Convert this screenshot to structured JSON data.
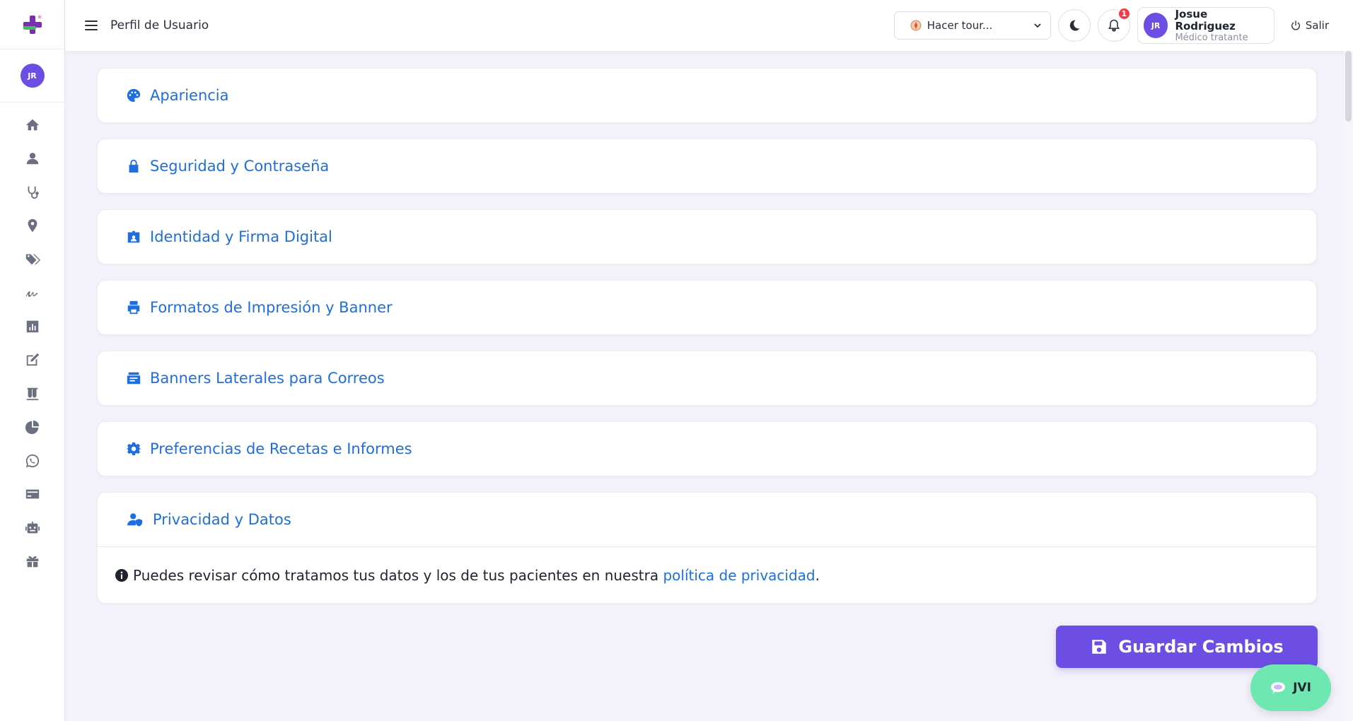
{
  "header": {
    "page_title": "Perfil de Usuario",
    "tour_label": "Hacer tour...",
    "notifications_count": "1",
    "user": {
      "initials": "JR",
      "name": "Josue Rodriguez",
      "role": "Médico tratante"
    },
    "logout_label": "Salir"
  },
  "sidebar": {
    "avatar_initials": "JR",
    "items": [
      {
        "icon": "home-icon"
      },
      {
        "icon": "user-icon"
      },
      {
        "icon": "stethoscope-icon"
      },
      {
        "icon": "location-pin-icon"
      },
      {
        "icon": "tags-icon"
      },
      {
        "icon": "signature-icon"
      },
      {
        "icon": "bar-chart-icon"
      },
      {
        "icon": "edit-icon"
      },
      {
        "icon": "test-tubes-icon"
      },
      {
        "icon": "pie-chart-icon"
      },
      {
        "icon": "whatsapp-icon"
      },
      {
        "icon": "credit-card-icon"
      },
      {
        "icon": "robot-icon"
      },
      {
        "icon": "gift-icon"
      }
    ]
  },
  "sections": [
    {
      "title": "Apariencia",
      "icon": "palette-icon"
    },
    {
      "title": "Seguridad y Contraseña",
      "icon": "lock-icon"
    },
    {
      "title": "Identidad y Firma Digital",
      "icon": "id-badge-icon"
    },
    {
      "title": "Formatos de Impresión y Banner",
      "icon": "printer-icon"
    },
    {
      "title": "Banners Laterales para Correos",
      "icon": "mail-box-icon"
    },
    {
      "title": "Preferencias de Recetas e Informes",
      "icon": "gear-icon"
    },
    {
      "title": "Privacidad y Datos",
      "icon": "user-shield-icon"
    }
  ],
  "privacy": {
    "text_before": "Puedes revisar cómo tratamos tus datos y los de tus pacientes en nuestra",
    "link_text": "política de privacidad",
    "text_after": "."
  },
  "save_label": "Guardar Cambios",
  "assistant_label": "JVI",
  "colors": {
    "accent": "#6c4ee4",
    "link": "#1d6fe0",
    "badge": "#ef3b4a",
    "assistant": "#6ee7b0"
  }
}
